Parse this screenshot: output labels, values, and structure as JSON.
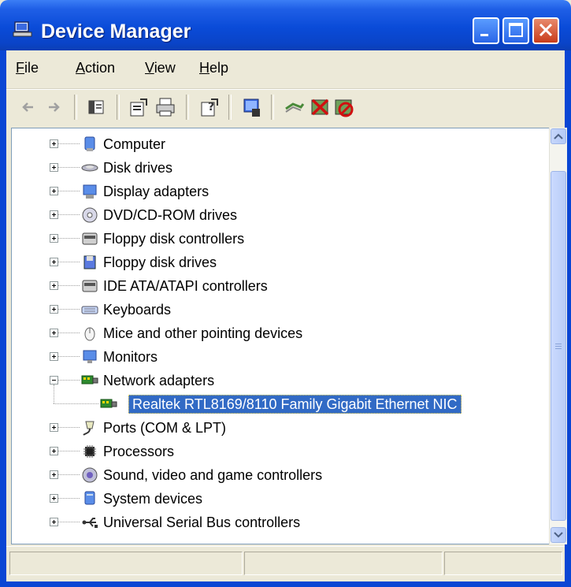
{
  "window": {
    "title": "Device Manager",
    "title_icon": "device-manager-icon"
  },
  "menu": [
    {
      "label": "File",
      "ul": "F",
      "rest": "ile"
    },
    {
      "label": "Action",
      "ul": "A",
      "rest": "ction"
    },
    {
      "label": "View",
      "ul": "V",
      "rest": "iew"
    },
    {
      "label": "Help",
      "ul": "H",
      "rest": "elp"
    }
  ],
  "toolbar": [
    "back-arrow-icon",
    "forward-arrow-icon",
    "show-hide-console-tree-icon",
    "properties-icon",
    "print-icon",
    "help-icon",
    "scan-hardware-changes-icon",
    "update-driver-icon",
    "uninstall-icon",
    "disable-icon"
  ],
  "tree": [
    {
      "label": "Computer",
      "icon": "computer-icon",
      "expanded": false
    },
    {
      "label": "Disk drives",
      "icon": "disk-drive-icon",
      "expanded": false
    },
    {
      "label": "Display adapters",
      "icon": "display-adapter-icon",
      "expanded": false
    },
    {
      "label": "DVD/CD-ROM drives",
      "icon": "cdrom-icon",
      "expanded": false
    },
    {
      "label": "Floppy disk controllers",
      "icon": "controller-icon",
      "expanded": false
    },
    {
      "label": "Floppy disk drives",
      "icon": "floppy-icon",
      "expanded": false
    },
    {
      "label": "IDE ATA/ATAPI controllers",
      "icon": "ide-controller-icon",
      "expanded": false
    },
    {
      "label": "Keyboards",
      "icon": "keyboard-icon",
      "expanded": false
    },
    {
      "label": "Mice and other pointing devices",
      "icon": "mouse-icon",
      "expanded": false
    },
    {
      "label": "Monitors",
      "icon": "monitor-icon",
      "expanded": false
    },
    {
      "label": "Network adapters",
      "icon": "network-adapter-icon",
      "expanded": true,
      "children": [
        {
          "label": "Realtek RTL8169/8110 Family Gigabit Ethernet NIC",
          "icon": "network-card-icon",
          "selected": true
        }
      ]
    },
    {
      "label": "Ports (COM & LPT)",
      "icon": "port-icon",
      "expanded": false
    },
    {
      "label": "Processors",
      "icon": "processor-icon",
      "expanded": false
    },
    {
      "label": "Sound, video and game controllers",
      "icon": "sound-icon",
      "expanded": false
    },
    {
      "label": "System devices",
      "icon": "system-device-icon",
      "expanded": false
    },
    {
      "label": "Universal Serial Bus controllers",
      "icon": "usb-icon",
      "expanded": false
    }
  ],
  "colors": {
    "selection": "#316ac5",
    "titlebar": "#0a4bd8"
  }
}
